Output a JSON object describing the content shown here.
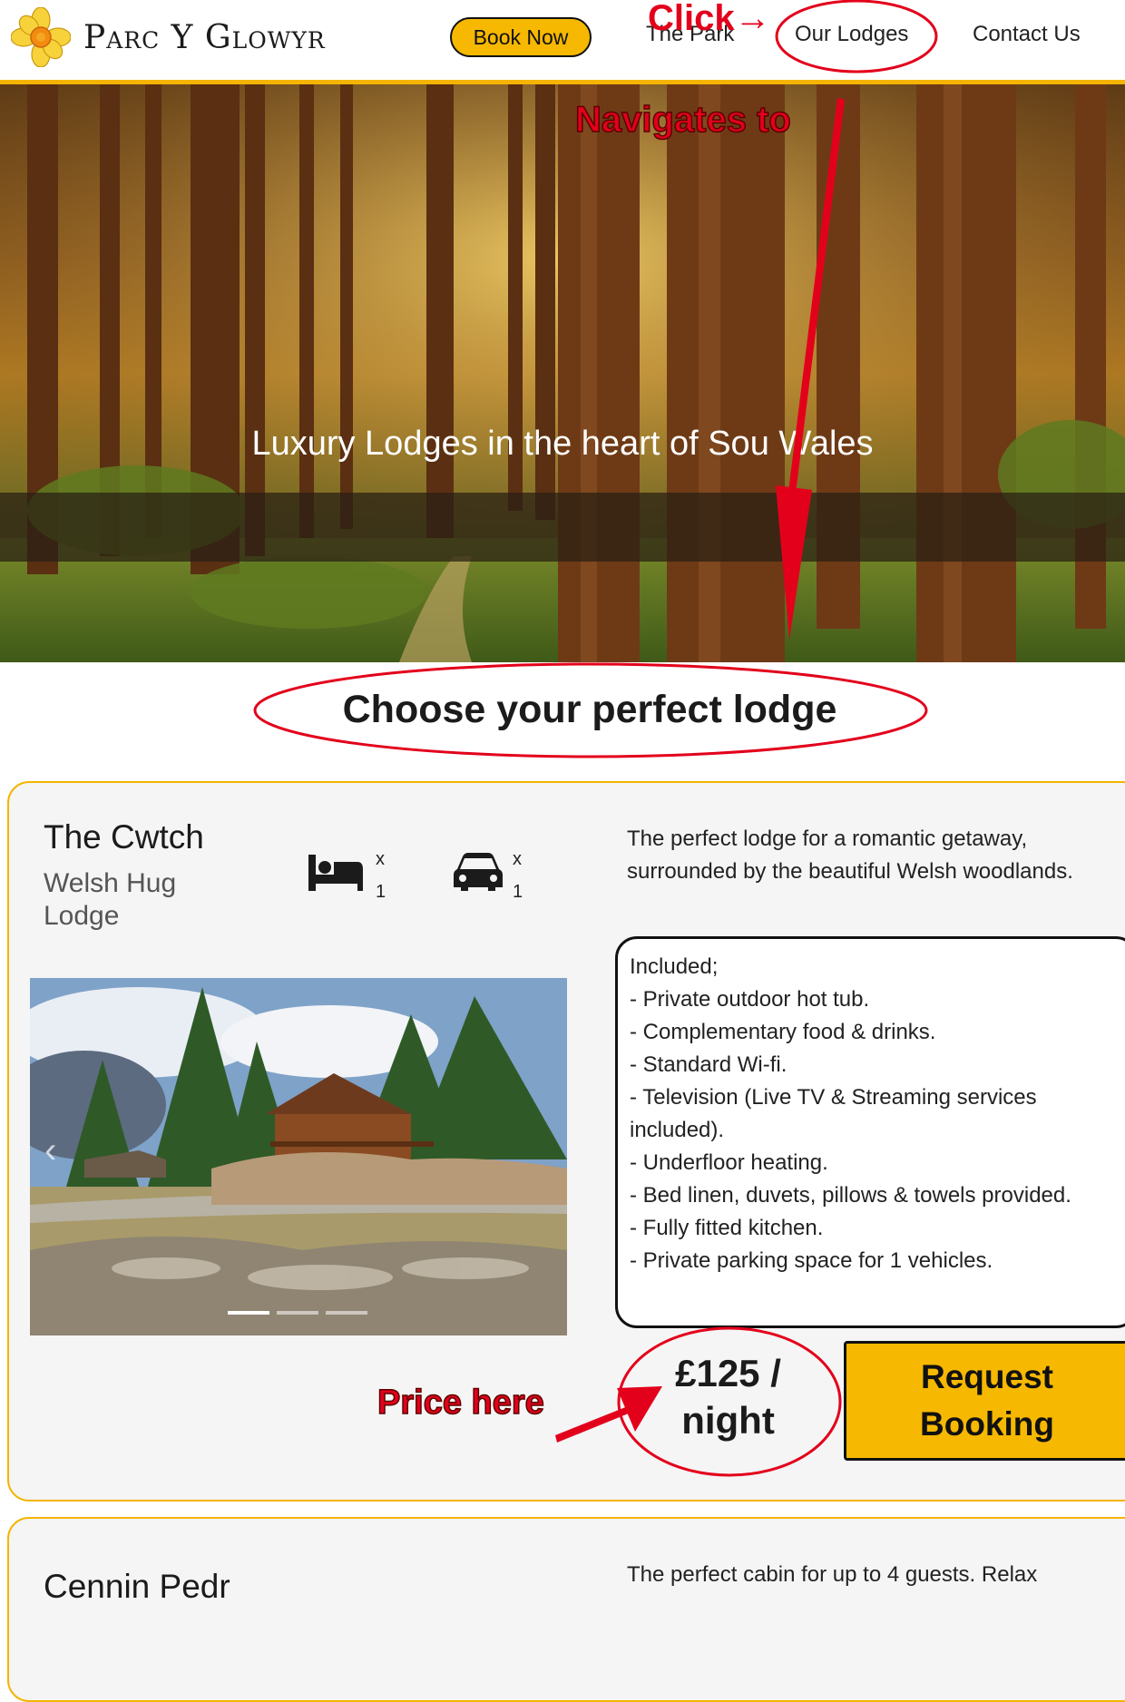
{
  "header": {
    "site_name": "Parc Y Glowyr",
    "book_now": "Book Now",
    "nav": {
      "park": "The Park",
      "lodges": "Our Lodges",
      "contact": "Contact Us"
    }
  },
  "hero": {
    "title": "Luxury Lodges in the heart of Sou   Wales"
  },
  "section": {
    "title": "Choose your perfect lodge"
  },
  "lodge": {
    "name": "The Cwtch",
    "subtitle": "Welsh Hug Lodge",
    "beds": {
      "x": "x",
      "count": "1"
    },
    "parking": {
      "x": "x",
      "count": "1"
    },
    "description": "The perfect lodge for a romantic getaway, surrounded by the beautiful Welsh woodlands.",
    "included_title": "Included;",
    "included": [
      "- Private outdoor hot tub.",
      "- Complementary food & drinks.",
      "- Standard Wi-fi.",
      "- Television (Live TV & Streaming services included).",
      "- Underfloor heating.",
      "- Bed linen, duvets, pillows & towels provided.",
      "- Fully fitted kitchen.",
      "- Private parking space for 1 vehicles."
    ],
    "price": "£125 / night",
    "price_line1": "£125 /",
    "price_line2": "night",
    "request_line1": "Request",
    "request_line2": "Booking",
    "gallery_dots": 3
  },
  "lodge2": {
    "name": "Cennin Pedr",
    "description": "The perfect cabin for up to 4 guests. Relax"
  },
  "annotations": {
    "click": "Click→",
    "navigates": "Navigates to",
    "price_here": "Price here",
    "color": "#e3001b"
  },
  "colors": {
    "accent": "#f6b800",
    "border": "#f4b400"
  }
}
